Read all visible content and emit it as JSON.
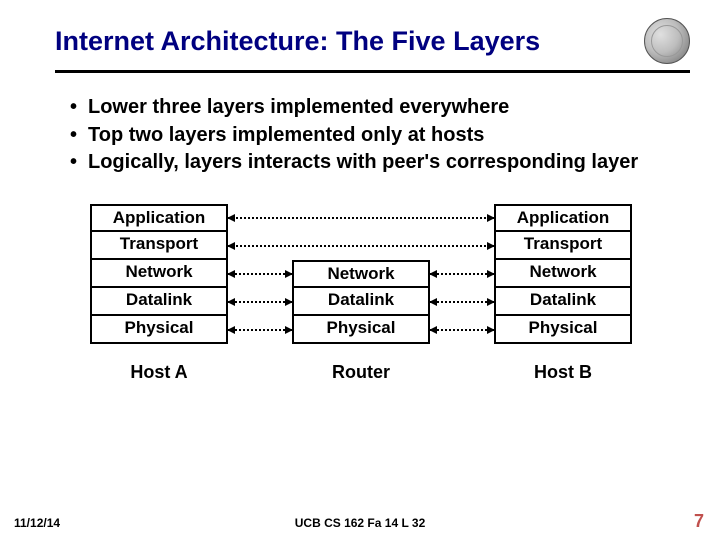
{
  "title": "Internet Architecture: The Five Layers",
  "bullets": [
    "Lower three layers implemented everywhere",
    "Top two layers implemented only at hosts",
    "Logically, layers interacts with peer's corresponding layer"
  ],
  "stacks": {
    "hostA": {
      "label": "Host A",
      "layers": [
        "Application",
        "Transport",
        "Network",
        "Datalink",
        "Physical"
      ]
    },
    "router": {
      "label": "Router",
      "layers": [
        "Network",
        "Datalink",
        "Physical"
      ]
    },
    "hostB": {
      "label": "Host B",
      "layers": [
        "Application",
        "Transport",
        "Network",
        "Datalink",
        "Physical"
      ]
    }
  },
  "footer": {
    "date": "11/12/14",
    "center": "UCB CS 162 Fa 14 L 32",
    "page": "7"
  }
}
